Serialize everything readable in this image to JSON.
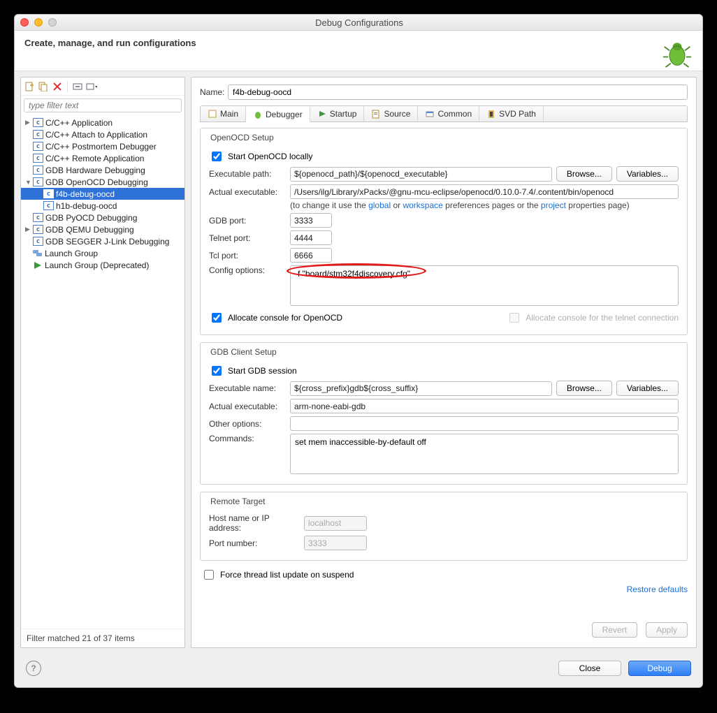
{
  "window": {
    "title": "Debug Configurations"
  },
  "header": {
    "subtitle": "Create, manage, and run configurations"
  },
  "sidebar": {
    "filter_placeholder": "type filter text",
    "items": [
      {
        "label": "C/C++ Application",
        "icon": "c"
      },
      {
        "label": "C/C++ Attach to Application",
        "icon": "c"
      },
      {
        "label": "C/C++ Postmortem Debugger",
        "icon": "c"
      },
      {
        "label": "C/C++ Remote Application",
        "icon": "c"
      },
      {
        "label": "GDB Hardware Debugging",
        "icon": "c"
      },
      {
        "label": "GDB OpenOCD Debugging",
        "icon": "c",
        "expanded": true,
        "children": [
          {
            "label": "f4b-debug-oocd",
            "icon": "c",
            "selected": true
          },
          {
            "label": "h1b-debug-oocd",
            "icon": "c"
          }
        ]
      },
      {
        "label": "GDB PyOCD Debugging",
        "icon": "c"
      },
      {
        "label": "GDB QEMU Debugging",
        "icon": "c",
        "expandable": true
      },
      {
        "label": "GDB SEGGER J-Link Debugging",
        "icon": "c"
      },
      {
        "label": "Launch Group",
        "icon": "launch"
      },
      {
        "label": "Launch Group (Deprecated)",
        "icon": "launch-green"
      }
    ],
    "status": "Filter matched 21 of 37 items"
  },
  "form": {
    "name_label": "Name:",
    "name_value": "f4b-debug-oocd",
    "tabs": [
      "Main",
      "Debugger",
      "Startup",
      "Source",
      "Common",
      "SVD Path"
    ],
    "active_tab": "Debugger",
    "openocd": {
      "group_title": "OpenOCD Setup",
      "start_local": "Start OpenOCD locally",
      "exe_path_label": "Executable path:",
      "exe_path": "${openocd_path}/${openocd_executable}",
      "actual_exe_label": "Actual executable:",
      "actual_exe": "/Users/ilg/Library/xPacks/@gnu-mcu-eclipse/openocd/0.10.0-7.4/.content/bin/openocd",
      "change_note_a": "(to change it use the ",
      "change_link_global": "global",
      "change_note_b": " or ",
      "change_link_workspace": "workspace",
      "change_note_c": " preferences pages or the ",
      "change_link_project": "project",
      "change_note_d": " properties page)",
      "gdb_port_label": "GDB port:",
      "gdb_port": "3333",
      "telnet_port_label": "Telnet port:",
      "telnet_port": "4444",
      "tcl_port_label": "Tcl port:",
      "tcl_port": "6666",
      "config_label": "Config options:",
      "config_value": "-f \"board/stm32f4discovery.cfg\"",
      "alloc_console": "Allocate console for OpenOCD",
      "alloc_telnet": "Allocate console for the telnet connection",
      "browse": "Browse...",
      "variables": "Variables..."
    },
    "gdb": {
      "group_title": "GDB Client Setup",
      "start_session": "Start GDB session",
      "exe_name_label": "Executable name:",
      "exe_name": "${cross_prefix}gdb${cross_suffix}",
      "actual_exe_label": "Actual executable:",
      "actual_exe": "arm-none-eabi-gdb",
      "other_label": "Other options:",
      "other_value": "",
      "commands_label": "Commands:",
      "commands_value": "set mem inaccessible-by-default off",
      "browse": "Browse...",
      "variables": "Variables..."
    },
    "remote": {
      "group_title": "Remote Target",
      "host_label": "Host name or IP address:",
      "host": "localhost",
      "port_label": "Port number:",
      "port": "3333"
    },
    "force_thread": "Force thread list update on suspend",
    "restore": "Restore defaults",
    "revert": "Revert",
    "apply": "Apply"
  },
  "footer": {
    "close": "Close",
    "debug": "Debug"
  }
}
